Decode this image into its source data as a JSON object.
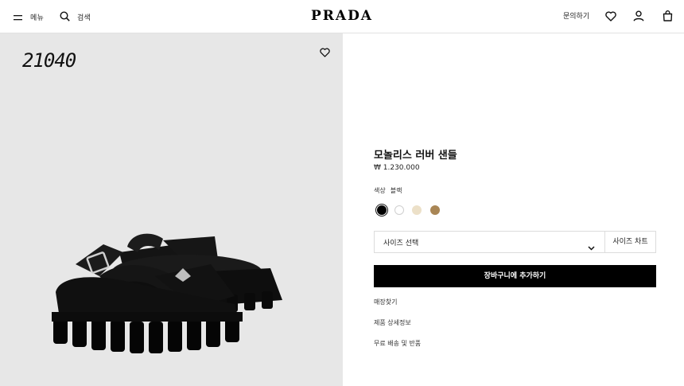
{
  "header": {
    "menu_label": "메뉴",
    "search_label": "검색",
    "logo": "PRADA",
    "contact_label": "문의하기",
    "icons": [
      "menu-icon",
      "search-icon",
      "heart-icon",
      "user-icon",
      "bag-icon"
    ]
  },
  "gallery": {
    "product_code": "21040",
    "wishlist_icon": "heart-icon"
  },
  "product": {
    "title": "모놀리스 러버 샌들",
    "price": "₩ 1.230.000",
    "color_label": "색상",
    "color_value": "블랙",
    "swatches": [
      {
        "name": "black",
        "color": "#000000",
        "selected": true
      },
      {
        "name": "white",
        "color": "#ffffff",
        "selected": false
      },
      {
        "name": "cream",
        "color": "#ece0c8",
        "selected": false
      },
      {
        "name": "tan",
        "color": "#a98655",
        "selected": false
      }
    ],
    "size_select_label": "사이즈 선택",
    "size_chart_label": "사이즈 차트",
    "add_to_cart_label": "장바구니에 추가하기",
    "links": [
      "매장찾기",
      "제품 상세정보",
      "무료 배송 및 반품"
    ]
  }
}
